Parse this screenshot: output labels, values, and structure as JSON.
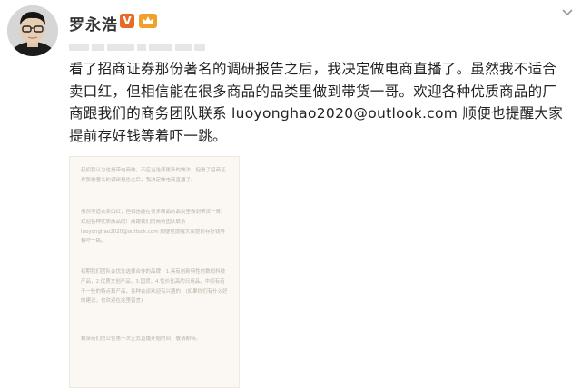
{
  "author": {
    "name": "罗永浩",
    "verified_badge": "V",
    "badge_color": "#e86a2a"
  },
  "post": {
    "text_before_link": "看了招商证券那份著名的调研报告之后，我决定做电商直播了。虽然我不适合卖口红，但相信能在很多商品的品类里做到带货一哥。欢迎各种优质商品的厂商跟我们的商务团队联系 ",
    "email": "luoyonghao2020@outlook.com",
    "text_after_link": " 顺便也提醒大家提前存好钱等着吓一跳。"
  },
  "image": {
    "paragraphs": [
      "起初我认为也是带电商做，不应当选择更多的做法，但看了招商证券那份著名的调研报告之后，我决定做电商直播了。",
      "虽然不适合卖口红，但相信能在很多商品的品类里做到带货一哥。欢迎各种优质商品的厂商跟我们的商务团队联系 luoyonghao2020@outlook.com 顺便也提醒大家提前存好钱等着吓一跳。",
      "初期我们团队会优先选择合作的品牌：1.具有创新特性的数码科技产品，2.优质文创产品，3.国货，4.性价比高的日用品。中间有若干一些的特点和产品，各种会谈欢迎有兴趣的，(如果你们有什么好的建议，也欢迎在这里留言)",
      "剩余商们的公告第一次正式直播开始时间，敬请期待。"
    ]
  },
  "colors": {
    "text": "#222222",
    "doc_background": "#fbf8f3",
    "doc_text": "#b9b2a6"
  }
}
